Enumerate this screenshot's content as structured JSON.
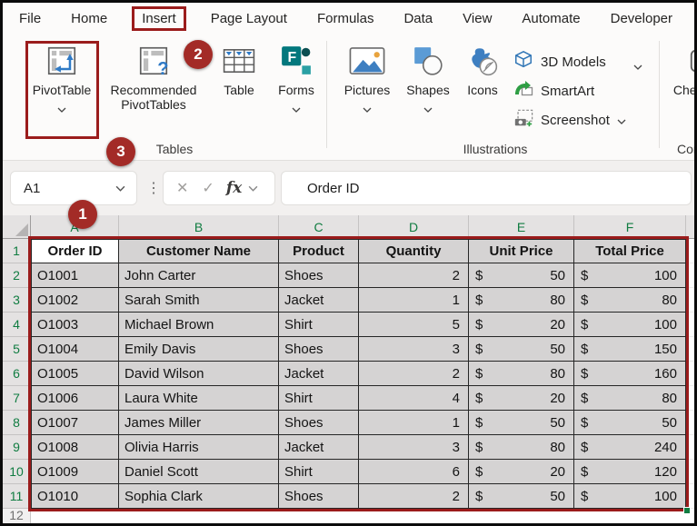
{
  "tabs": {
    "items": [
      "File",
      "Home",
      "Insert",
      "Page Layout",
      "Formulas",
      "Data",
      "View",
      "Automate",
      "Developer"
    ],
    "active": "Insert"
  },
  "ribbon": {
    "tables_group": {
      "label": "Tables",
      "pivottable": "PivotTable",
      "recommended": "Recommended\nPivotTables",
      "table": "Table",
      "forms": "Forms"
    },
    "illustrations_group": {
      "label": "Illustrations",
      "pictures": "Pictures",
      "shapes": "Shapes",
      "icons": "Icons",
      "models3d": "3D Models",
      "smartart": "SmartArt",
      "screenshot": "Screenshot"
    },
    "controls_group": {
      "label": "Controls",
      "checkbox": "Checkbox"
    }
  },
  "formula_bar": {
    "name_box": "A1",
    "cancel_icon": "✕",
    "enter_icon": "✓",
    "fx_label": "fx",
    "grip_icon": "⋮",
    "formula": "Order ID"
  },
  "annotations": {
    "step1": "1",
    "step2": "2",
    "step3": "3"
  },
  "grid": {
    "currency": "$",
    "column_letters": [
      "A",
      "B",
      "C",
      "D",
      "E",
      "F"
    ],
    "header_row_number": "1",
    "partial_row_number": "12",
    "headers": [
      "Order ID",
      "Customer Name",
      "Product",
      "Quantity",
      "Unit Price",
      "Total Price"
    ],
    "rows": [
      {
        "row": "2",
        "id": "O1001",
        "name": "John Carter",
        "product": "Shoes",
        "qty": "2",
        "unit": "50",
        "total": "100"
      },
      {
        "row": "3",
        "id": "O1002",
        "name": "Sarah Smith",
        "product": "Jacket",
        "qty": "1",
        "unit": "80",
        "total": "80"
      },
      {
        "row": "4",
        "id": "O1003",
        "name": "Michael Brown",
        "product": "Shirt",
        "qty": "5",
        "unit": "20",
        "total": "100"
      },
      {
        "row": "5",
        "id": "O1004",
        "name": "Emily Davis",
        "product": "Shoes",
        "qty": "3",
        "unit": "50",
        "total": "150"
      },
      {
        "row": "6",
        "id": "O1005",
        "name": "David Wilson",
        "product": "Jacket",
        "qty": "2",
        "unit": "80",
        "total": "160"
      },
      {
        "row": "7",
        "id": "O1006",
        "name": "Laura White",
        "product": "Shirt",
        "qty": "4",
        "unit": "20",
        "total": "80"
      },
      {
        "row": "8",
        "id": "O1007",
        "name": "James Miller",
        "product": "Shoes",
        "qty": "1",
        "unit": "50",
        "total": "50"
      },
      {
        "row": "9",
        "id": "O1008",
        "name": "Olivia Harris",
        "product": "Jacket",
        "qty": "3",
        "unit": "80",
        "total": "240"
      },
      {
        "row": "10",
        "id": "O1009",
        "name": "Daniel Scott",
        "product": "Shirt",
        "qty": "6",
        "unit": "20",
        "total": "120"
      },
      {
        "row": "11",
        "id": "O1010",
        "name": "Sophia Clark",
        "product": "Shoes",
        "qty": "2",
        "unit": "50",
        "total": "100"
      }
    ]
  },
  "colors": {
    "annotation_red": "#9B1C1C",
    "annotation_circle_red": "#A32B27",
    "excel_green": "#107C41",
    "selection_gray": "#D5D3D3",
    "icon_blue": "#2F7AC6",
    "forms_teal": "#03787D"
  }
}
